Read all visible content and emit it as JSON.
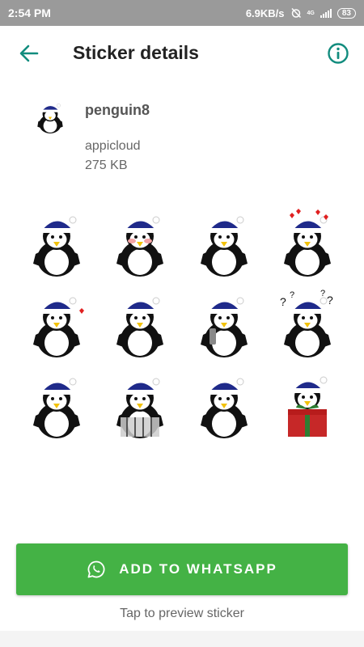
{
  "status_bar": {
    "time": "2:54 PM",
    "network_speed": "6.9KB/s",
    "network_type": "4G",
    "battery": "83",
    "icons": [
      "alarm-off-icon",
      "signal-icon",
      "battery-icon"
    ]
  },
  "app_bar": {
    "title": "Sticker details",
    "back_icon": "arrow-left-icon",
    "info_icon": "info-icon",
    "accent": "#128c7e"
  },
  "pack": {
    "name": "penguin8",
    "publisher": "appicloud",
    "size": "275 KB"
  },
  "stickers": [
    {
      "id": "s1",
      "pose": "thumbs-up-grin"
    },
    {
      "id": "s2",
      "pose": "blushing-thumbs-up"
    },
    {
      "id": "s3",
      "pose": "thumbs-up"
    },
    {
      "id": "s4",
      "pose": "heart-eyes"
    },
    {
      "id": "s5",
      "pose": "blowing-kiss"
    },
    {
      "id": "s6",
      "pose": "thumbs-down"
    },
    {
      "id": "s7",
      "pose": "phone-call"
    },
    {
      "id": "s8",
      "pose": "confused"
    },
    {
      "id": "s9",
      "pose": "arms-crossed"
    },
    {
      "id": "s10",
      "pose": "behind-bars"
    },
    {
      "id": "s11",
      "pose": "pointing"
    },
    {
      "id": "s12",
      "pose": "gift-box"
    }
  ],
  "footer": {
    "add_button_label": "ADD TO WHATSAPP",
    "add_button_icon": "whatsapp-icon",
    "add_button_color": "#44b245",
    "preview_hint": "Tap to preview sticker"
  }
}
